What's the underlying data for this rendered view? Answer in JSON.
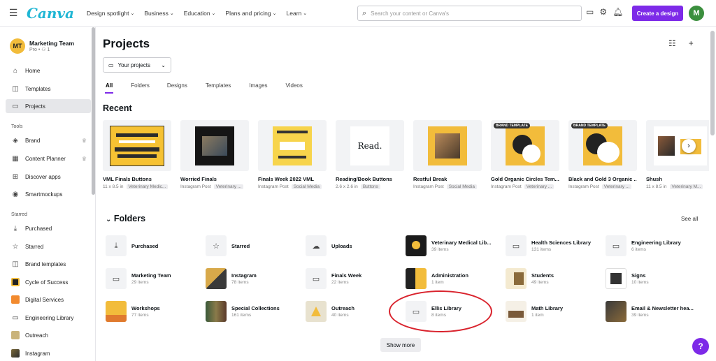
{
  "header": {
    "logo": "Canva",
    "nav": [
      "Design spotlight",
      "Business",
      "Education",
      "Plans and pricing",
      "Learn"
    ],
    "search_placeholder": "Search your content or Canva's",
    "create_label": "Create a design",
    "user_initial": "M"
  },
  "sidebar": {
    "team_initials": "MT",
    "team_name": "Marketing Team",
    "team_sub": "Pro • ⚇ 1",
    "main_items": [
      "Home",
      "Templates",
      "Projects"
    ],
    "tools_heading": "Tools",
    "tools_items": [
      "Brand",
      "Content Planner",
      "Discover apps",
      "Smartmockups"
    ],
    "starred_heading": "Starred",
    "starred_items": [
      "Purchased",
      "Starred",
      "Brand templates",
      "Cycle of Success",
      "Digital Services",
      "Engineering Library",
      "Outreach",
      "Instagram"
    ]
  },
  "main": {
    "title": "Projects",
    "dropdown_label": "Your projects",
    "tabs": [
      "All",
      "Folders",
      "Designs",
      "Templates",
      "Images",
      "Videos"
    ],
    "recent_title": "Recent",
    "brand_badge": "BRAND TEMPLATE",
    "designs": [
      {
        "name": "VML Finals Buttons",
        "meta": "11 x 8.5 in",
        "badge": "Veterinary Medic..."
      },
      {
        "name": "Worried Finals",
        "meta": "Instagram Post",
        "badge": "Veterinary ..."
      },
      {
        "name": "Finals Week 2022 VML",
        "meta": "Instagram Post",
        "badge": "Social Media"
      },
      {
        "name": "Reading/Book Buttons",
        "meta": "2.6 x 2.6 in",
        "badge": "Buttons"
      },
      {
        "name": "Restful Break",
        "meta": "Instagram Post",
        "badge": "Social Media"
      },
      {
        "name": "Gold Organic Circles Tem...",
        "meta": "Instagram Post",
        "badge": "Veterinary ..."
      },
      {
        "name": "Black and Gold 3 Organic ...",
        "meta": "Instagram Post",
        "badge": "Veterinary ..."
      },
      {
        "name": "Shush",
        "meta": "11 x 8.5 in",
        "badge": "Veterinary M..."
      }
    ],
    "reading_thumb_text": "Read.",
    "folders_title": "Folders",
    "see_all": "See all",
    "folders": [
      {
        "name": "Purchased",
        "count": ""
      },
      {
        "name": "Starred",
        "count": ""
      },
      {
        "name": "Uploads",
        "count": ""
      },
      {
        "name": "Veterinary Medical Lib...",
        "count": "39 items"
      },
      {
        "name": "Health Sciences Library",
        "count": "131 items"
      },
      {
        "name": "Engineering Library",
        "count": "6 items"
      },
      {
        "name": "Marketing Team",
        "count": "29 items"
      },
      {
        "name": "Instagram",
        "count": "78 items"
      },
      {
        "name": "Finals Week",
        "count": "22 items"
      },
      {
        "name": "Administration",
        "count": "1 item"
      },
      {
        "name": "Students",
        "count": "49 items"
      },
      {
        "name": "Signs",
        "count": "10 items"
      },
      {
        "name": "Workshops",
        "count": "77 items"
      },
      {
        "name": "Special Collections",
        "count": "161 items"
      },
      {
        "name": "Outreach",
        "count": "40 items"
      },
      {
        "name": "Ellis Library",
        "count": "8 items"
      },
      {
        "name": "Math Library",
        "count": "1 item"
      },
      {
        "name": "Email & Newsletter hea...",
        "count": "39 items"
      }
    ],
    "show_more": "Show more",
    "help": "?"
  },
  "colors": {
    "accent": "#7d2ae8",
    "logo": "#1fb6d4",
    "gold": "#f2bc3b",
    "annotation": "#d9232d"
  }
}
